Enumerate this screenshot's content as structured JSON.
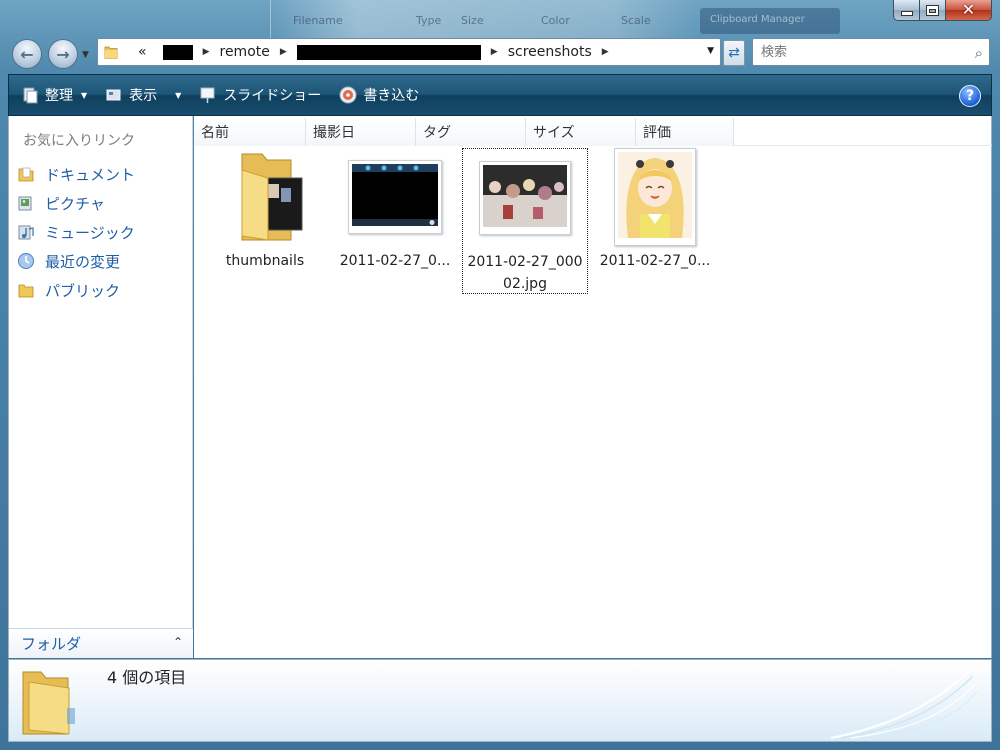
{
  "titlebar": {
    "ghost_columns": [
      "Filename",
      "Type",
      "Size",
      "Color",
      "Scale"
    ],
    "ghost_window_label": "Clipboard Manager"
  },
  "address": {
    "prefix": "«",
    "crumbs": [
      "remote",
      "screenshots"
    ]
  },
  "search": {
    "placeholder": "検索"
  },
  "commands": {
    "organize": "整理",
    "views": "表示",
    "slideshow": "スライドショー",
    "burn": "書き込む",
    "help": "?"
  },
  "navpane": {
    "favorites_title": "お気に入りリンク",
    "items": [
      {
        "label": "ドキュメント",
        "icon": "documents-folder-icon"
      },
      {
        "label": "ピクチャ",
        "icon": "pictures-icon"
      },
      {
        "label": "ミュージック",
        "icon": "music-icon"
      },
      {
        "label": "最近の変更",
        "icon": "recent-changes-icon"
      },
      {
        "label": "パブリック",
        "icon": "public-folder-icon"
      }
    ],
    "folders_label": "フォルダ"
  },
  "columns": [
    "名前",
    "撮影日",
    "タグ",
    "サイズ",
    "評価"
  ],
  "files": [
    {
      "name": "thumbnails",
      "kind": "folder"
    },
    {
      "name": "2011-02-27_0...",
      "kind": "image"
    },
    {
      "name": "2011-02-27_00002.jpg",
      "kind": "image",
      "selected": true
    },
    {
      "name": "2011-02-27_0...",
      "kind": "image"
    }
  ],
  "details": {
    "count": "4 個の項目"
  },
  "colors": {
    "command_bar": "#1d5576",
    "link_text": "#1f5ea8",
    "frame": "#4f88ad"
  }
}
